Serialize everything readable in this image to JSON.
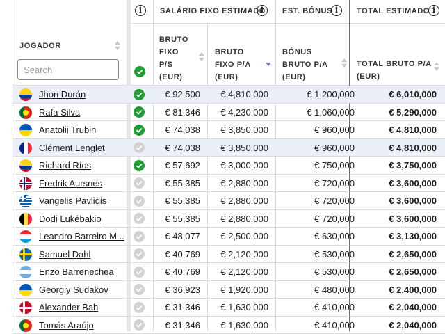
{
  "headers": {
    "salario_group": "SALÁRIO FIXO ESTIMADO",
    "bonus_group": "EST. BÓNUS",
    "total_group": "TOTAL ESTIMADO",
    "jogador": "JOGADOR",
    "bruto_ps": "BRUTO\nFIXO\nP/S\n(EUR)",
    "bruto_pa": "BRUTO\nFIXO P/A\n(EUR)",
    "bonus_pa": "BÓNUS\nBRUTO P/A\n(EUR)",
    "total_pa": "TOTAL BRUTO P/A\n(EUR)"
  },
  "search": {
    "placeholder": "Search"
  },
  "colors": {
    "check_on": "#1f9d35",
    "check_off": "#d2d2d2",
    "row_highlight": "#ebeff7",
    "sort_active": "#6b7fc9"
  },
  "players": [
    {
      "name": "Jhon Durán",
      "flag": "colombia",
      "verified": true,
      "ps": "€ 92,500",
      "pa": "€ 4,810,000",
      "bonus": "€ 1,200,000",
      "total": "€ 6,010,000",
      "highlight": true
    },
    {
      "name": "Rafa Silva",
      "flag": "portugal",
      "verified": true,
      "ps": "€ 81,346",
      "pa": "€ 4,230,000",
      "bonus": "€ 1,060,000",
      "total": "€ 5,290,000",
      "highlight": false
    },
    {
      "name": "Anatolii Trubin",
      "flag": "ukraine",
      "verified": true,
      "ps": "€ 74,038",
      "pa": "€ 3,850,000",
      "bonus": "€ 960,000",
      "total": "€ 4,810,000",
      "highlight": false
    },
    {
      "name": "Clément Lenglet",
      "flag": "france",
      "verified": false,
      "ps": "€ 74,038",
      "pa": "€ 3,850,000",
      "bonus": "€ 960,000",
      "total": "€ 4,810,000",
      "highlight": true
    },
    {
      "name": "Richard Ríos",
      "flag": "colombia",
      "verified": true,
      "ps": "€ 57,692",
      "pa": "€ 3,000,000",
      "bonus": "€ 750,000",
      "total": "€ 3,750,000",
      "highlight": false
    },
    {
      "name": "Fredrik Aursnes",
      "flag": "norway",
      "verified": false,
      "ps": "€ 55,385",
      "pa": "€ 2,880,000",
      "bonus": "€ 720,000",
      "total": "€ 3,600,000",
      "highlight": false
    },
    {
      "name": "Vangelis Pavlidis",
      "flag": "greece",
      "verified": false,
      "ps": "€ 55,385",
      "pa": "€ 2,880,000",
      "bonus": "€ 720,000",
      "total": "€ 3,600,000",
      "highlight": false
    },
    {
      "name": "Dodi Lukébakio",
      "flag": "belgium",
      "verified": false,
      "ps": "€ 55,385",
      "pa": "€ 2,880,000",
      "bonus": "€ 720,000",
      "total": "€ 3,600,000",
      "highlight": false
    },
    {
      "name": "Leandro Barreiro M...",
      "flag": "luxembourg",
      "verified": false,
      "ps": "€ 48,077",
      "pa": "€ 2,500,000",
      "bonus": "€ 630,000",
      "total": "€ 3,130,000",
      "highlight": false
    },
    {
      "name": "Samuel Dahl",
      "flag": "sweden",
      "verified": false,
      "ps": "€ 40,769",
      "pa": "€ 2,120,000",
      "bonus": "€ 530,000",
      "total": "€ 2,650,000",
      "highlight": false
    },
    {
      "name": "Enzo Barrenechea",
      "flag": "argentina",
      "verified": false,
      "ps": "€ 40,769",
      "pa": "€ 2,120,000",
      "bonus": "€ 530,000",
      "total": "€ 2,650,000",
      "highlight": false
    },
    {
      "name": "Georgiy Sudakov",
      "flag": "ukraine",
      "verified": false,
      "ps": "€ 36,923",
      "pa": "€ 1,920,000",
      "bonus": "€ 480,000",
      "total": "€ 2,400,000",
      "highlight": false
    },
    {
      "name": "Alexander Bah",
      "flag": "denmark",
      "verified": false,
      "ps": "€ 31,346",
      "pa": "€ 1,630,000",
      "bonus": "€ 410,000",
      "total": "€ 2,040,000",
      "highlight": false
    },
    {
      "name": "Tomás Araújo",
      "flag": "portugal",
      "verified": false,
      "ps": "€ 31,346",
      "pa": "€ 1,630,000",
      "bonus": "€ 410,000",
      "total": "€ 2,040,000",
      "highlight": false
    }
  ]
}
